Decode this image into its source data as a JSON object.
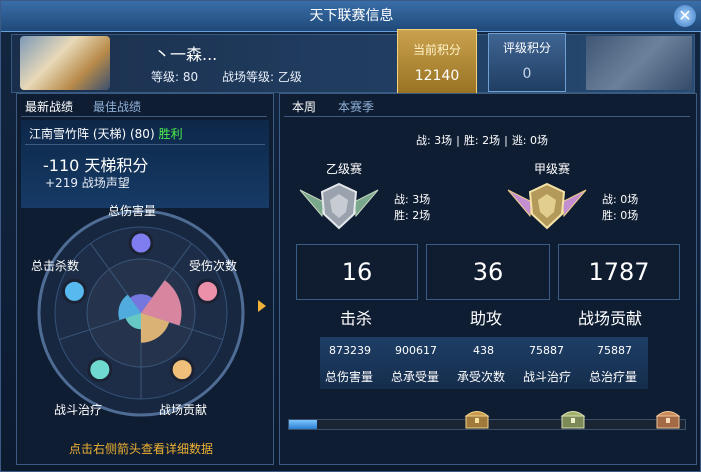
{
  "window": {
    "title": "天下联赛信息",
    "close_label": "✕"
  },
  "player": {
    "name": "丶一森...",
    "level_text": "等级: 80",
    "battlefield_level_text": "战场等级: 乙级"
  },
  "scores": {
    "current": {
      "label": "当前积分",
      "value": "12140"
    },
    "rating": {
      "label": "评级积分",
      "value": "0"
    }
  },
  "left_tabs": [
    {
      "label": "最新战绩",
      "active": true
    },
    {
      "label": "最佳战绩",
      "active": false
    }
  ],
  "battle": {
    "title": "江南雪竹阵 (天梯) (80)",
    "result": "胜利",
    "ladder_change": "-110 天梯积分",
    "prestige_change": "+219 战场声望"
  },
  "radar": {
    "labels": [
      "总伤害量",
      "受伤次数",
      "战场贡献",
      "战斗治疗",
      "总击杀数"
    ],
    "levels": [
      0.35,
      0.75,
      0.55,
      0.3,
      0.42
    ],
    "colors": [
      "#7f7df0",
      "#ec8fa8",
      "#f0c07a",
      "#6fd9d0",
      "#57b9ee"
    ]
  },
  "hint": "点击右侧箭头查看详细数据",
  "right_tabs": [
    {
      "label": "本周",
      "active": true
    },
    {
      "label": "本赛季",
      "active": false
    }
  ],
  "record": {
    "battles": "战: 3场",
    "wins": "胜: 2场",
    "escapes": "逃: 0场"
  },
  "leagues": [
    {
      "title": "乙级赛",
      "battles": "战: 3场",
      "wins": "胜: 2场"
    },
    {
      "title": "甲级赛",
      "battles": "战: 0场",
      "wins": "胜: 0场"
    }
  ],
  "big_stats": [
    {
      "value": "16",
      "label": "击杀"
    },
    {
      "value": "36",
      "label": "助攻"
    },
    {
      "value": "1787",
      "label": "战场贡献"
    }
  ],
  "details": [
    {
      "value": "873239",
      "label": "总伤害量"
    },
    {
      "value": "900617",
      "label": "总承受量"
    },
    {
      "value": "438",
      "label": "承受次数"
    },
    {
      "value": "75887",
      "label": "战斗治疗"
    },
    {
      "value": "75887",
      "label": "总治疗量"
    }
  ],
  "progress": {
    "fraction": 0.07
  },
  "colors": {
    "accent_gold": "#f0b233",
    "win_green": "#4cf04c",
    "tab_blue": "#8fb1d8"
  }
}
